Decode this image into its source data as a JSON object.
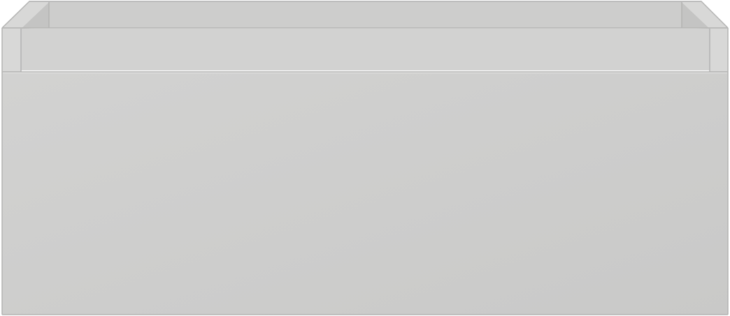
{
  "object": {
    "kind": "drawer-cabinet",
    "icon": "drawer-box-icon",
    "colors": {
      "front_light": "#d2d2d1",
      "front_dark": "#c9c9c8",
      "rim": "#d8d8d7",
      "inner_wall": "#c4c4c3",
      "inner_back": "#cdcdcc",
      "edge": "#b3b3b2",
      "highlight": "#e6e6e5"
    }
  }
}
